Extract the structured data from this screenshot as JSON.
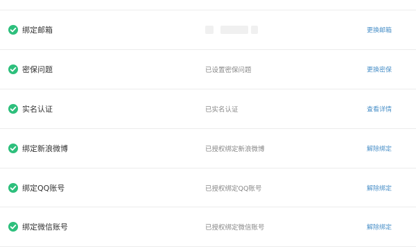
{
  "security_items": [
    {
      "label": "绑定邮箱",
      "status": "",
      "status_masked": true,
      "action": "更换邮箱"
    },
    {
      "label": "密保问题",
      "status": "已设置密保问题",
      "status_masked": false,
      "action": "更换密保"
    },
    {
      "label": "实名认证",
      "status": "已实名认证",
      "status_masked": false,
      "action": "查看详情"
    },
    {
      "label": "绑定新浪微博",
      "status": "已授权绑定新浪微博",
      "status_masked": false,
      "action": "解除绑定"
    },
    {
      "label": "绑定QQ账号",
      "status": "已授权绑定QQ账号",
      "status_masked": false,
      "action": "解除绑定"
    },
    {
      "label": "绑定微信账号",
      "status": "已授权绑定微信账号",
      "status_masked": false,
      "action": "解除绑定"
    }
  ],
  "colors": {
    "check": "#2dbf7c",
    "link": "#4a90c8",
    "label": "#333333",
    "status": "#888888",
    "divider": "#ececec"
  },
  "icons": {
    "status_icon": "check-circle-icon"
  }
}
